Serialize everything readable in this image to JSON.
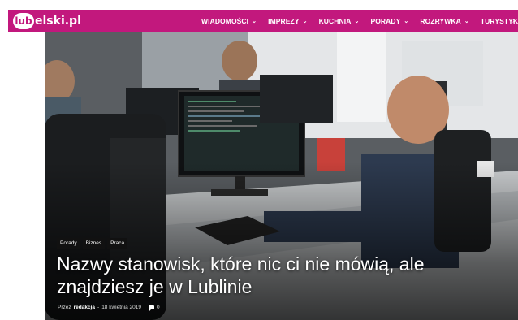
{
  "logo": {
    "circle_text": "lub",
    "rest_text": "elski.pl"
  },
  "nav": {
    "items": [
      {
        "label": "WIADOMOŚCI"
      },
      {
        "label": "IMPREZY"
      },
      {
        "label": "KUCHNIA"
      },
      {
        "label": "PORADY"
      },
      {
        "label": "ROZRYWKA"
      },
      {
        "label": "TURYSTYKA"
      }
    ]
  },
  "hero": {
    "categories": [
      "Porady",
      "Biznes",
      "Praca"
    ],
    "title_line1": "Nazwy stanowisk, które nic ci nie mówią, ale",
    "title_line2": "znajdziesz je w Lublinie",
    "meta": {
      "by": "Przez",
      "author": "redakcja",
      "separator": "-",
      "date": "18 kwietnia 2019",
      "comments": "0"
    }
  },
  "colors": {
    "brand": "#c2187d"
  }
}
